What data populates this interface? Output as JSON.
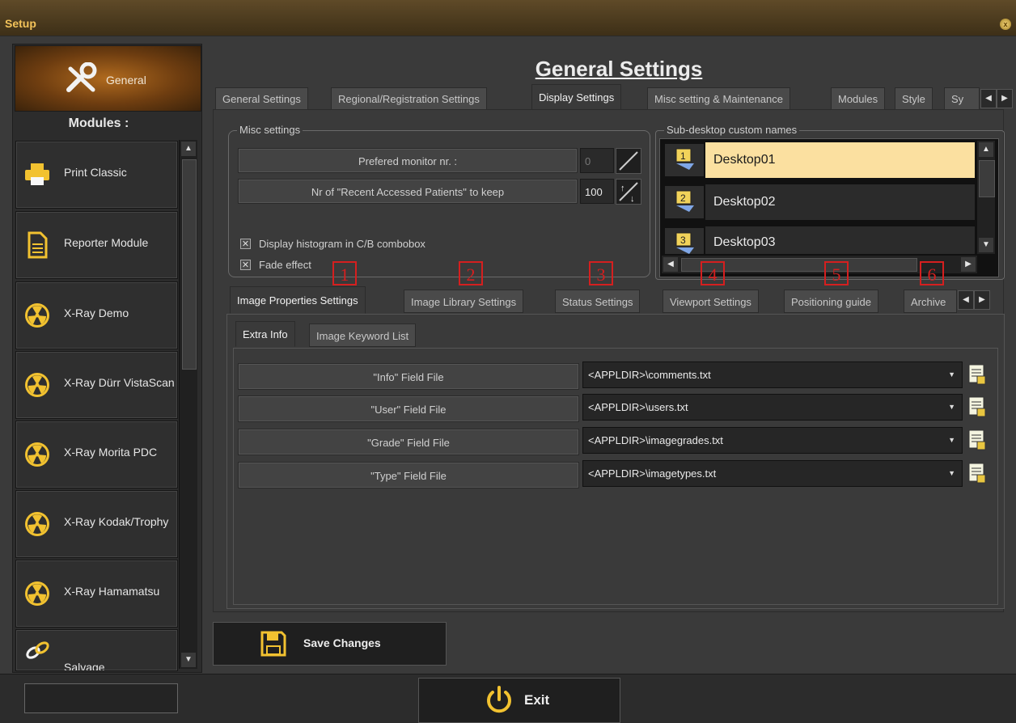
{
  "window": {
    "title": "Setup"
  },
  "sidebar": {
    "general_label": "General",
    "modules_title": "Modules :",
    "modules": [
      {
        "label": "Print Classic",
        "icon": "printer-icon"
      },
      {
        "label": "Reporter Module",
        "icon": "document-icon"
      },
      {
        "label": "X-Ray Demo",
        "icon": "radiation-icon"
      },
      {
        "label": "X-Ray Dürr VistaScan",
        "icon": "radiation-icon"
      },
      {
        "label": "X-Ray Morita PDC",
        "icon": "radiation-icon"
      },
      {
        "label": "X-Ray Kodak/Trophy",
        "icon": "radiation-icon"
      },
      {
        "label": "X-Ray Hamamatsu",
        "icon": "radiation-icon"
      },
      {
        "label": "Salvage",
        "icon": "links-icon"
      }
    ]
  },
  "main": {
    "heading": "General Settings",
    "tabs": [
      "General Settings",
      "Regional/Registration Settings",
      "Display Settings",
      "Misc setting & Maintenance",
      "Modules",
      "Style",
      "Sy"
    ],
    "active_tab": "Display Settings",
    "misc": {
      "legend": "Misc settings",
      "monitor_label": "Prefered monitor nr. :",
      "monitor_value": "0",
      "recent_label": "Nr of \"Recent Accessed Patients\" to keep",
      "recent_value": "100",
      "histogram_label": "Display histogram in C/B combobox",
      "fade_label": "Fade effect",
      "histogram_checked": true,
      "fade_checked": true
    },
    "subdesktop": {
      "legend": "Sub-desktop custom names",
      "items": [
        {
          "label": "Desktop01",
          "num": "1"
        },
        {
          "label": "Desktop02",
          "num": "2"
        },
        {
          "label": "Desktop03",
          "num": "3"
        }
      ]
    },
    "markers": [
      "1",
      "2",
      "3",
      "4",
      "5",
      "6"
    ],
    "subtabs": [
      "Image Properties Settings",
      "Image Library Settings",
      "Status Settings",
      "Viewport Settings",
      "Positioning guide",
      "Archive"
    ],
    "active_subtab": "Image Properties Settings",
    "innertabs": [
      "Extra Info",
      "Image Keyword List"
    ],
    "active_innertab": "Extra Info",
    "filerows": [
      {
        "label": "\"Info\" Field File",
        "value": "<APPLDIR>\\comments.txt"
      },
      {
        "label": "\"User\" Field File",
        "value": "<APPLDIR>\\users.txt"
      },
      {
        "label": "\"Grade\" Field File",
        "value": "<APPLDIR>\\imagegrades.txt"
      },
      {
        "label": "\"Type\" Field File",
        "value": "<APPLDIR>\\imagetypes.txt"
      }
    ]
  },
  "footer": {
    "save_label": "Save Changes",
    "exit_label": "Exit"
  },
  "colors": {
    "accent": "#f3c35a",
    "selection": "#fbe0a0",
    "marker": "#d51f1f"
  }
}
